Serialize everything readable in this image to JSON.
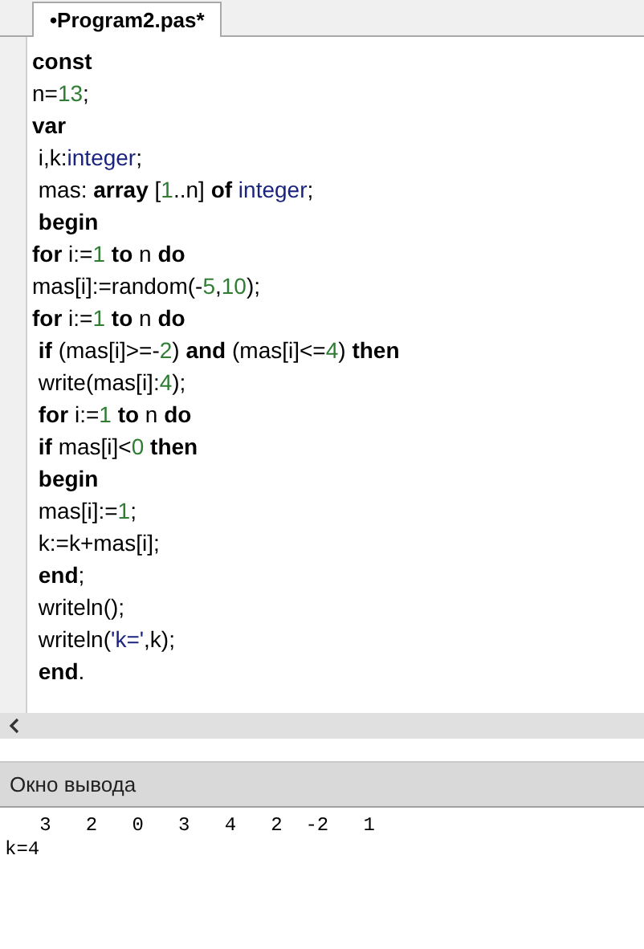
{
  "tabs": [
    {
      "label": "•Program2.pas*",
      "selected": true
    }
  ],
  "code_lines": [
    [
      {
        "kind": "kw",
        "text": "const"
      }
    ],
    [
      {
        "kind": "plain",
        "text": "n="
      },
      {
        "kind": "num",
        "text": "13"
      },
      {
        "kind": "plain",
        "text": ";"
      }
    ],
    [
      {
        "kind": "kw",
        "text": "var"
      }
    ],
    [
      {
        "kind": "plain",
        "text": " i,k:"
      },
      {
        "kind": "type",
        "text": "integer"
      },
      {
        "kind": "plain",
        "text": ";"
      }
    ],
    [
      {
        "kind": "plain",
        "text": " mas: "
      },
      {
        "kind": "kw",
        "text": "array"
      },
      {
        "kind": "plain",
        "text": " ["
      },
      {
        "kind": "num",
        "text": "1"
      },
      {
        "kind": "plain",
        "text": "..n] "
      },
      {
        "kind": "kw",
        "text": "of"
      },
      {
        "kind": "type",
        "text": " integer"
      },
      {
        "kind": "plain",
        "text": ";"
      }
    ],
    [
      {
        "kind": "kw",
        "text": " begin"
      }
    ],
    [
      {
        "kind": "kw",
        "text": "for"
      },
      {
        "kind": "plain",
        "text": " i:="
      },
      {
        "kind": "num",
        "text": "1"
      },
      {
        "kind": "kw",
        "text": " to"
      },
      {
        "kind": "plain",
        "text": " n "
      },
      {
        "kind": "kw",
        "text": "do"
      }
    ],
    [
      {
        "kind": "plain",
        "text": "mas[i]:=random(-"
      },
      {
        "kind": "num",
        "text": "5"
      },
      {
        "kind": "plain",
        "text": ","
      },
      {
        "kind": "num",
        "text": "10"
      },
      {
        "kind": "plain",
        "text": ");"
      }
    ],
    [
      {
        "kind": "kw",
        "text": "for"
      },
      {
        "kind": "plain",
        "text": " i:="
      },
      {
        "kind": "num",
        "text": "1"
      },
      {
        "kind": "kw",
        "text": " to"
      },
      {
        "kind": "plain",
        "text": " n "
      },
      {
        "kind": "kw",
        "text": "do"
      }
    ],
    [
      {
        "kind": "kw",
        "text": " if"
      },
      {
        "kind": "plain",
        "text": " (mas[i]>=-"
      },
      {
        "kind": "num",
        "text": "2"
      },
      {
        "kind": "plain",
        "text": ") "
      },
      {
        "kind": "kw",
        "text": "and"
      },
      {
        "kind": "plain",
        "text": " (mas[i]<="
      },
      {
        "kind": "num",
        "text": "4"
      },
      {
        "kind": "plain",
        "text": ") "
      },
      {
        "kind": "kw",
        "text": "then"
      }
    ],
    [
      {
        "kind": "plain",
        "text": " write(mas[i]:"
      },
      {
        "kind": "num",
        "text": "4"
      },
      {
        "kind": "plain",
        "text": ");"
      }
    ],
    [
      {
        "kind": "kw",
        "text": " for"
      },
      {
        "kind": "plain",
        "text": " i:="
      },
      {
        "kind": "num",
        "text": "1"
      },
      {
        "kind": "kw",
        "text": " to"
      },
      {
        "kind": "plain",
        "text": " n "
      },
      {
        "kind": "kw",
        "text": "do"
      }
    ],
    [
      {
        "kind": "kw",
        "text": " if"
      },
      {
        "kind": "plain",
        "text": " mas[i]<"
      },
      {
        "kind": "num",
        "text": "0"
      },
      {
        "kind": "kw",
        "text": " then"
      }
    ],
    [
      {
        "kind": "kw",
        "text": " begin"
      }
    ],
    [
      {
        "kind": "plain",
        "text": " mas[i]:="
      },
      {
        "kind": "num",
        "text": "1"
      },
      {
        "kind": "plain",
        "text": ";"
      }
    ],
    [
      {
        "kind": "plain",
        "text": " k:=k+mas[i];"
      }
    ],
    [
      {
        "kind": "kw",
        "text": " end"
      },
      {
        "kind": "plain",
        "text": ";"
      }
    ],
    [
      {
        "kind": "plain",
        "text": " writeln();"
      }
    ],
    [
      {
        "kind": "plain",
        "text": " writeln("
      },
      {
        "kind": "str",
        "text": "'k='"
      },
      {
        "kind": "plain",
        "text": ",k);"
      }
    ],
    [
      {
        "kind": "kw",
        "text": " end"
      },
      {
        "kind": "plain",
        "text": "."
      }
    ]
  ],
  "output_panel": {
    "title": "Окно вывода",
    "lines": [
      "   3   2   0   3   4   2  -2   1",
      "k=4"
    ]
  }
}
